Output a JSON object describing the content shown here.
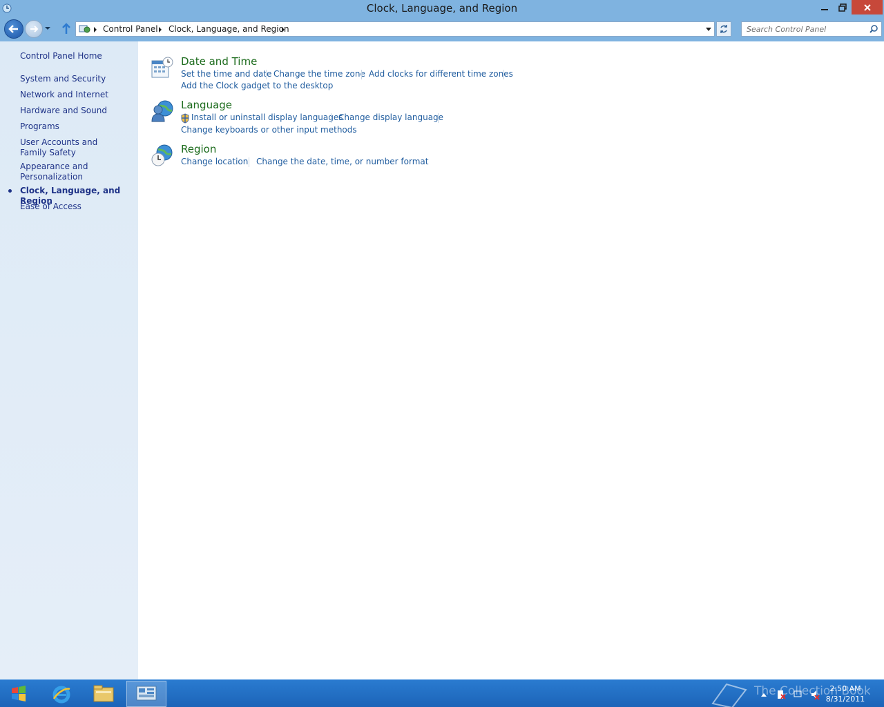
{
  "window": {
    "title": "Clock, Language, and Region"
  },
  "address_bar": {
    "crumbs": [
      "Control Panel",
      "Clock, Language, and Region"
    ]
  },
  "search": {
    "placeholder": "Search Control Panel"
  },
  "sidebar": {
    "items": [
      {
        "label": "Control Panel Home"
      },
      {
        "label": "System and Security"
      },
      {
        "label": "Network and Internet"
      },
      {
        "label": "Hardware and Sound"
      },
      {
        "label": "Programs"
      },
      {
        "label": "User Accounts and Family Safety"
      },
      {
        "label": "Appearance and Personalization"
      },
      {
        "label": "Clock, Language, and Region",
        "current": true
      },
      {
        "label": "Ease of Access"
      }
    ]
  },
  "categories": [
    {
      "title": "Date and Time",
      "icon": "calendar-clock-icon",
      "tasks": [
        "Set the time and date",
        "Change the time zone",
        "Add clocks for different time zones",
        "Add the Clock gadget to the desktop"
      ]
    },
    {
      "title": "Language",
      "icon": "language-globe-icon",
      "tasks": [
        "Install or uninstall display languages",
        "Change display language",
        "Change keyboards or other input methods"
      ]
    },
    {
      "title": "Region",
      "icon": "region-globe-clock-icon",
      "tasks": [
        "Change location",
        "Change the date, time, or number format"
      ]
    }
  ],
  "taskbar": {
    "apps": [
      "internet-explorer-icon",
      "file-explorer-icon",
      "control-panel-icon"
    ],
    "watermark": "The Collection Book",
    "clock_time": "2:50 AM",
    "clock_date": "8/31/2011"
  },
  "colors": {
    "chrome": "#7fb3e0",
    "link": "#1e5b9e",
    "category_title": "#1c6b1c",
    "sidebar_link": "#1e3287",
    "taskbar": "#1c64b8"
  }
}
